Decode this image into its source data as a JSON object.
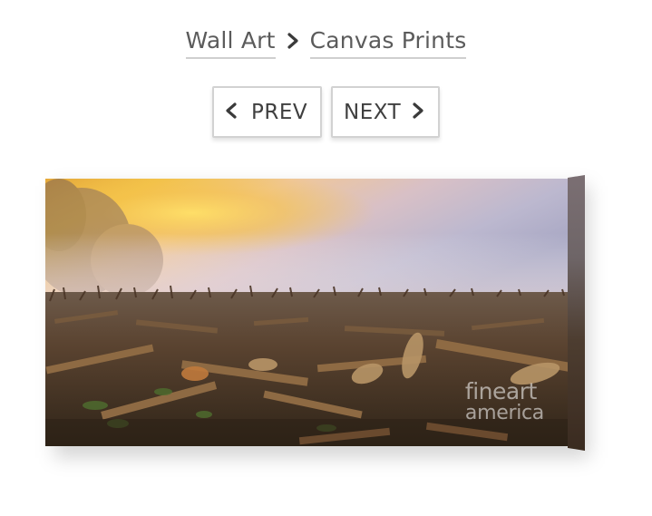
{
  "breadcrumb": {
    "items": [
      {
        "label": "Wall Art"
      },
      {
        "label": "Canvas Prints"
      }
    ]
  },
  "pager": {
    "prev_label": "PREV",
    "next_label": "NEXT"
  },
  "product": {
    "image_alt": "Canvas print of a harvested corn field at foggy sunrise",
    "watermark_line1": "fineart",
    "watermark_line2": "america"
  },
  "colors": {
    "text": "#5b5b5b",
    "button_border": "#d2d2d2",
    "sky_glow": "#f4c04a"
  },
  "icons": {
    "crumb_separator": "chevron-right-icon",
    "prev": "chevron-left-icon",
    "next": "chevron-right-icon"
  }
}
